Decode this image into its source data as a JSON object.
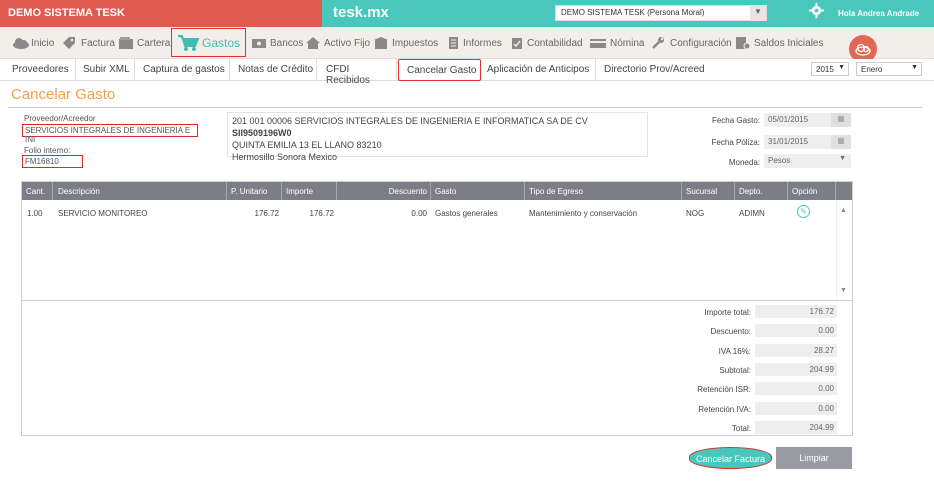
{
  "topbar": {
    "system_name": "DEMO SISTEMA TESK",
    "brand": "tesk.mx",
    "company_select": "DEMO SISTEMA TESK (Persona Moral)",
    "greeting": "Hola Andrea Andrade"
  },
  "mainnav": {
    "items": [
      {
        "label": "Inicio"
      },
      {
        "label": "Factura"
      },
      {
        "label": "Cartera"
      },
      {
        "label": "Gastos"
      },
      {
        "label": "Bancos"
      },
      {
        "label": "Activo Fijo"
      },
      {
        "label": "Impuestos"
      },
      {
        "label": "Informes"
      },
      {
        "label": "Contabilidad"
      },
      {
        "label": "Nómina"
      },
      {
        "label": "Configuración"
      },
      {
        "label": "Saldos Iniciales"
      }
    ]
  },
  "subnav": {
    "items": [
      {
        "label": "Proveedores"
      },
      {
        "label": "Subir XML"
      },
      {
        "label": "Captura de gastos"
      },
      {
        "label": "Notas de Crédito"
      },
      {
        "label": "CFDI Recibidos"
      },
      {
        "label": "Cancelar Gasto"
      },
      {
        "label": "Aplicación de Anticipos"
      },
      {
        "label": "Directorio Prov/Acreed"
      }
    ],
    "year": "2015",
    "month": "Enero"
  },
  "page": {
    "title": "Cancelar Gasto"
  },
  "form": {
    "proveedor_label": "Proveedor/Acreedor",
    "proveedor_value": "SERVICIOS INTEGRALES DE INGENIERIA E INI",
    "folio_label": "Folio interno:",
    "folio_value": "FM16810",
    "address_line1": "201 001 00006 SERVICIOS INTEGRALES DE INGENIERIA E INFORMATICA SA DE CV",
    "address_rfc": "SII9509196W0",
    "address_line2": "QUINTA EMILIA 13 EL LLANO 83210",
    "address_line3": "Hermosillo Sonora Mexico",
    "fecha_gasto_label": "Fecha Gasto:",
    "fecha_gasto_value": "05/01/2015",
    "fecha_poliza_label": "Fecha Póliza:",
    "fecha_poliza_value": "31/01/2015",
    "moneda_label": "Moneda:",
    "moneda_value": "Pesos"
  },
  "grid": {
    "headers": [
      "Cant.",
      "Descripción",
      "P. Unitario",
      "Importe",
      "Descuento",
      "Gasto",
      "Tipo de Egreso",
      "Sucursal",
      "Depto.",
      "Opción"
    ],
    "rows": [
      {
        "cant": "1.00",
        "descripcion": "SERVICIO MONITOREO",
        "p_unitario": "176.72",
        "importe": "176.72",
        "descuento": "0.00",
        "gasto": "Gastos generales",
        "tipo_egreso": "Mantenimiento y conservación",
        "sucursal": "NOG",
        "depto": "ADIMN"
      }
    ]
  },
  "totals": {
    "importe_total_label": "Importe total:",
    "importe_total": "176.72",
    "descuento_label": "Descuento:",
    "descuento": "0.00",
    "iva_label": "IVA 16%:",
    "iva": "28.27",
    "subtotal_label": "Subtotal:",
    "subtotal": "204.99",
    "ret_isr_label": "Retención ISR:",
    "ret_isr": "0.00",
    "ret_iva_label": "Retención IVA:",
    "ret_iva": "0.00",
    "total_label": "Total:",
    "total": "204.99"
  },
  "actions": {
    "cancel_label": "Cancelar Factura",
    "clear_label": "Limpiar"
  },
  "colors": {
    "brand_red": "#e05a4f",
    "brand_teal": "#49c7bd",
    "title_orange": "#f0a04b",
    "highlight_red": "#d62b26"
  }
}
